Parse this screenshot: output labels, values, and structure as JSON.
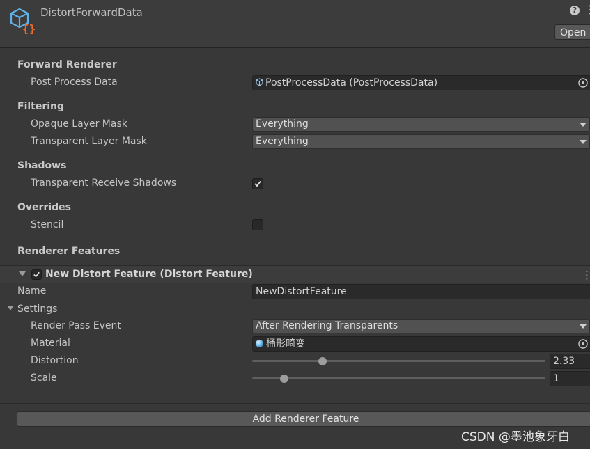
{
  "header": {
    "title": "DistortForwardData",
    "help_glyph": "?",
    "open_label": "Open",
    "icon": "scriptable-object-icon"
  },
  "forward_renderer": {
    "heading": "Forward Renderer",
    "post_process_label": "Post Process Data",
    "post_process_value": "PostProcessData (PostProcessData)"
  },
  "filtering": {
    "heading": "Filtering",
    "opaque_label": "Opaque Layer Mask",
    "opaque_value": "Everything",
    "transparent_label": "Transparent Layer Mask",
    "transparent_value": "Everything"
  },
  "shadows": {
    "heading": "Shadows",
    "receive_label": "Transparent Receive Shadows",
    "receive_checked": true
  },
  "overrides": {
    "heading": "Overrides",
    "stencil_label": "Stencil",
    "stencil_checked": false
  },
  "renderer_features": {
    "heading": "Renderer Features",
    "feature_title": "New Distort Feature (Distort Feature)",
    "feature_enabled": true,
    "name_label": "Name",
    "name_value": "NewDistortFeature",
    "settings_label": "Settings",
    "render_pass_label": "Render Pass Event",
    "render_pass_value": "After Rendering Transparents",
    "material_label": "Material",
    "material_value": "桶形畸变",
    "distortion_label": "Distortion",
    "distortion_value": "2.33",
    "distortion_fraction": 0.24,
    "scale_label": "Scale",
    "scale_value": "1",
    "scale_fraction": 0.11
  },
  "add_feature_label": "Add Renderer Feature",
  "watermark": "CSDN @墨池象牙白",
  "colors": {
    "background": "#383838",
    "field": "#2a2a2a",
    "dropdown": "#515151",
    "button": "#585858",
    "icon_blue": "#5fb2e8",
    "icon_orange": "#f06a2a"
  }
}
